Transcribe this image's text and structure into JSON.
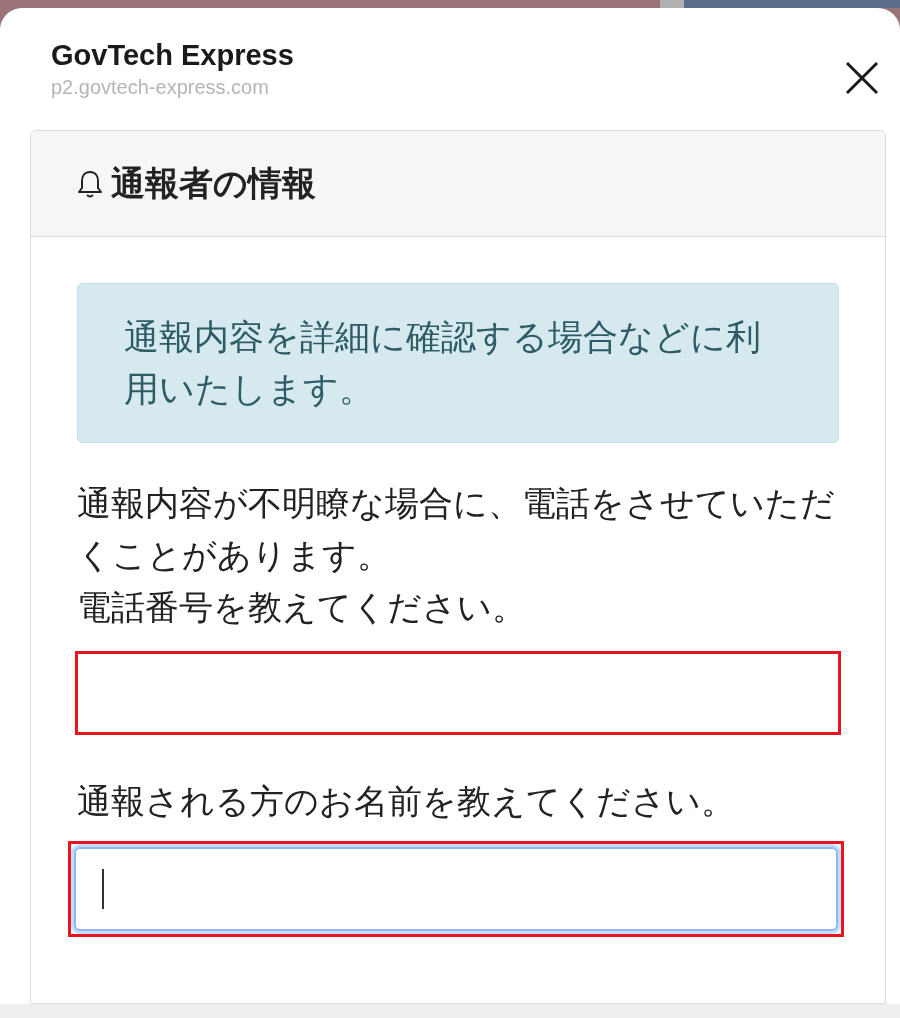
{
  "header": {
    "title": "GovTech Express",
    "url": "p2.govtech-express.com"
  },
  "card": {
    "title": "通報者の情報",
    "alert": "通報内容を詳細に確認する場合などに利用いたします。",
    "fields": [
      {
        "label_lines": [
          "通報内容が不明瞭な場合に、電話をさせていただくことがあります。",
          "電話番号を教えてください。"
        ],
        "focused": false,
        "highlighted": true
      },
      {
        "label_lines": [
          "通報される方のお名前を教えてください。"
        ],
        "focused": true,
        "highlighted": true
      }
    ]
  }
}
